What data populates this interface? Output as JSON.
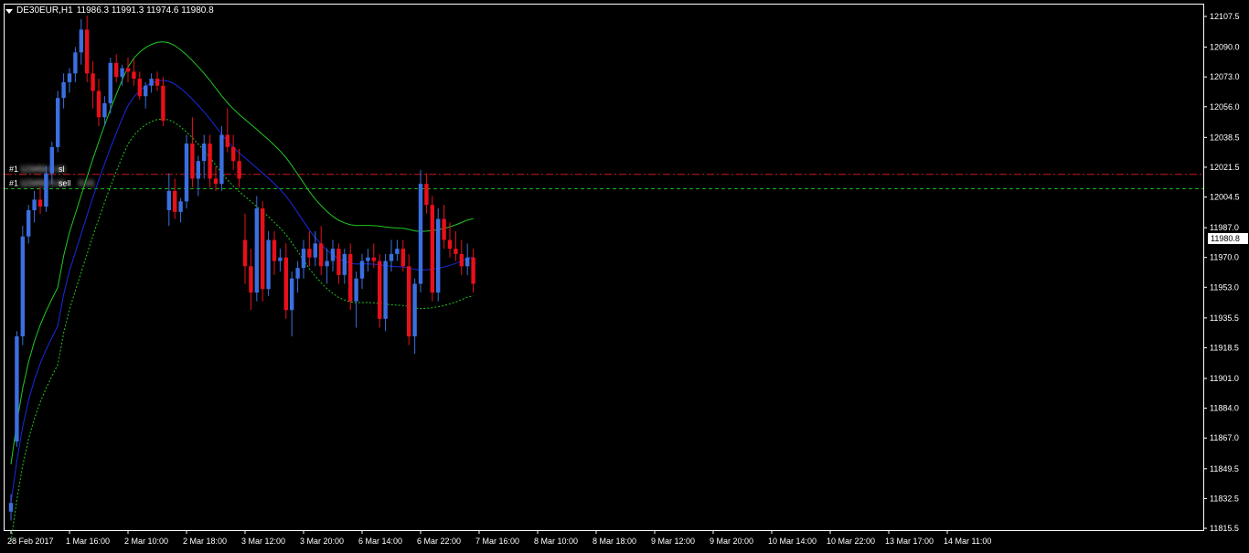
{
  "header": {
    "symbol": "DE30EUR,H1",
    "ohlc": "11986.3 11991.3 11974.6 11980.8"
  },
  "colors": {
    "background": "#000000",
    "frame": "#ffffff",
    "bull": "#3b6fe0",
    "bear": "#e8101a",
    "ma_upper": "#22c822",
    "ma_mid": "#1a2ae0",
    "ma_lower": "#22c822",
    "sl_line": "#d01818",
    "order_line": "#18b018",
    "price_box": "#ffffff"
  },
  "orders": [
    {
      "label_prefix": "#1",
      "label_hidden": "123456 0.01",
      "label_suffix": "sl",
      "price": 12017.4,
      "color": "#d01818"
    },
    {
      "label_prefix": "#1",
      "label_hidden": "123456 0.01",
      "label_suffix": "sell",
      "price": 12009.2,
      "color": "#18b018",
      "extra_hidden": "0.01"
    }
  ],
  "current_price": "11980.8",
  "chart_data": {
    "type": "candlestick",
    "title": "DE30EUR,H1",
    "ylim": [
      11815.5,
      12115.0
    ],
    "y_ticks": [
      "12107.5",
      "12090.0",
      "12073.0",
      "12056.0",
      "12038.5",
      "12021.5",
      "12004.5",
      "11987.0",
      "11970.0",
      "11953.0",
      "11935.5",
      "11918.5",
      "11901.0",
      "11884.0",
      "11867.0",
      "11849.5",
      "11832.5",
      "11815.5"
    ],
    "x_ticks": [
      {
        "label": "28 Feb 2017",
        "index": 0
      },
      {
        "label": "1 Mar 16:00",
        "index": 10
      },
      {
        "label": "2 Mar 10:00",
        "index": 20
      },
      {
        "label": "2 Mar 18:00",
        "index": 30
      },
      {
        "label": "3 Mar 12:00",
        "index": 40
      },
      {
        "label": "3 Mar 20:00",
        "index": 50
      },
      {
        "label": "6 Mar 14:00",
        "index": 60
      },
      {
        "label": "6 Mar 22:00",
        "index": 70
      },
      {
        "label": "7 Mar 16:00",
        "index": 80
      },
      {
        "label": "8 Mar 10:00",
        "index": 90
      },
      {
        "label": "8 Mar 18:00",
        "index": 100
      },
      {
        "label": "9 Mar 12:00",
        "index": 110
      },
      {
        "label": "9 Mar 20:00",
        "index": 120
      },
      {
        "label": "10 Mar 14:00",
        "index": 130
      },
      {
        "label": "10 Mar 22:00",
        "index": 140
      },
      {
        "label": "13 Mar 17:00",
        "index": 150
      },
      {
        "label": "14 Mar 11:00",
        "index": 160
      }
    ],
    "candles": [
      [
        11825,
        11835,
        11820,
        11830
      ],
      [
        11865,
        11928,
        11862,
        11925
      ],
      [
        11925,
        11988,
        11920,
        11982
      ],
      [
        11982,
        12000,
        11978,
        11997
      ],
      [
        11997,
        12008,
        11990,
        12003
      ],
      [
        12003,
        12010,
        11995,
        11999
      ],
      [
        11999,
        12022,
        11996,
        12018
      ],
      [
        12018,
        12036,
        12012,
        12033
      ],
      [
        12033,
        12065,
        12030,
        12061
      ],
      [
        12061,
        12075,
        12055,
        12070
      ],
      [
        12070,
        12078,
        12064,
        12075
      ],
      [
        12075,
        12090,
        12070,
        12087
      ],
      [
        12087,
        12106,
        12080,
        12100
      ],
      [
        12100,
        12108,
        12070,
        12075
      ],
      [
        12075,
        12082,
        12055,
        12065
      ],
      [
        12065,
        12072,
        12045,
        12050
      ],
      [
        12050,
        12062,
        12045,
        12058
      ],
      [
        12058,
        12084,
        12052,
        12081
      ],
      [
        12081,
        12086,
        12070,
        12073
      ],
      [
        12073,
        12080,
        12068,
        12078
      ],
      [
        12078,
        12084,
        12070,
        12076
      ],
      [
        12076,
        12083,
        12068,
        12072
      ],
      [
        12072,
        12076,
        12060,
        12062
      ],
      [
        12062,
        12070,
        12055,
        12068
      ],
      [
        12068,
        12075,
        12064,
        12072
      ],
      [
        12072,
        12076,
        12065,
        12068
      ],
      [
        12068,
        12073,
        12045,
        12048
      ],
      [
        11997,
        12018,
        11988,
        12008
      ],
      [
        12008,
        12015,
        11992,
        11996
      ],
      [
        11996,
        12004,
        11990,
        12002
      ],
      [
        12002,
        12040,
        11998,
        12035
      ],
      [
        12035,
        12050,
        12010,
        12015
      ],
      [
        12015,
        12028,
        12005,
        12025
      ],
      [
        12025,
        12040,
        12015,
        12035
      ],
      [
        12035,
        12040,
        12010,
        12015
      ],
      [
        12015,
        12022,
        12008,
        12012
      ],
      [
        12012,
        12045,
        12008,
        12040
      ],
      [
        12040,
        12055,
        12030,
        12033
      ],
      [
        12033,
        12040,
        12020,
        12025
      ],
      [
        12025,
        12032,
        12010,
        12015
      ],
      [
        11980,
        11995,
        11955,
        11965
      ],
      [
        11965,
        11975,
        11940,
        11950
      ],
      [
        11950,
        12005,
        11945,
        11998
      ],
      [
        11998,
        12002,
        11945,
        11952
      ],
      [
        11952,
        11985,
        11948,
        11980
      ],
      [
        11980,
        11985,
        11960,
        11968
      ],
      [
        11968,
        11975,
        11962,
        11970
      ],
      [
        11970,
        11978,
        11935,
        11940
      ],
      [
        11940,
        11962,
        11925,
        11958
      ],
      [
        11958,
        11968,
        11950,
        11964
      ],
      [
        11964,
        11980,
        11958,
        11975
      ],
      [
        11975,
        11985,
        11965,
        11970
      ],
      [
        11970,
        11985,
        11965,
        11978
      ],
      [
        11978,
        11988,
        11960,
        11965
      ],
      [
        11965,
        11975,
        11955,
        11968
      ],
      [
        11968,
        11980,
        11962,
        11975
      ],
      [
        11975,
        11978,
        11955,
        11960
      ],
      [
        11960,
        11975,
        11955,
        11972
      ],
      [
        11972,
        11978,
        11940,
        11945
      ],
      [
        11945,
        11962,
        11930,
        11958
      ],
      [
        11958,
        11972,
        11952,
        11968
      ],
      [
        11968,
        11975,
        11962,
        11970
      ],
      [
        11970,
        11978,
        11964,
        11968
      ],
      [
        11968,
        11972,
        11930,
        11935
      ],
      [
        11935,
        11972,
        11928,
        11968
      ],
      [
        11968,
        11980,
        11962,
        11972
      ],
      [
        11972,
        11980,
        11968,
        11975
      ],
      [
        11975,
        11980,
        11962,
        11965
      ],
      [
        11965,
        11972,
        11920,
        11925
      ],
      [
        11925,
        11958,
        11915,
        11955
      ],
      [
        11955,
        12020,
        11950,
        12012
      ],
      [
        12012,
        12018,
        11995,
        12000
      ],
      [
        12000,
        12005,
        11945,
        11950
      ],
      [
        11950,
        11998,
        11945,
        11992
      ],
      [
        11992,
        12000,
        11975,
        11980
      ],
      [
        11980,
        11990,
        11970,
        11975
      ],
      [
        11975,
        11985,
        11968,
        11972
      ],
      [
        11972,
        11980,
        11960,
        11965
      ],
      [
        11965,
        11978,
        11960,
        11970
      ],
      [
        11970,
        11975,
        11950,
        11955
      ]
    ]
  }
}
